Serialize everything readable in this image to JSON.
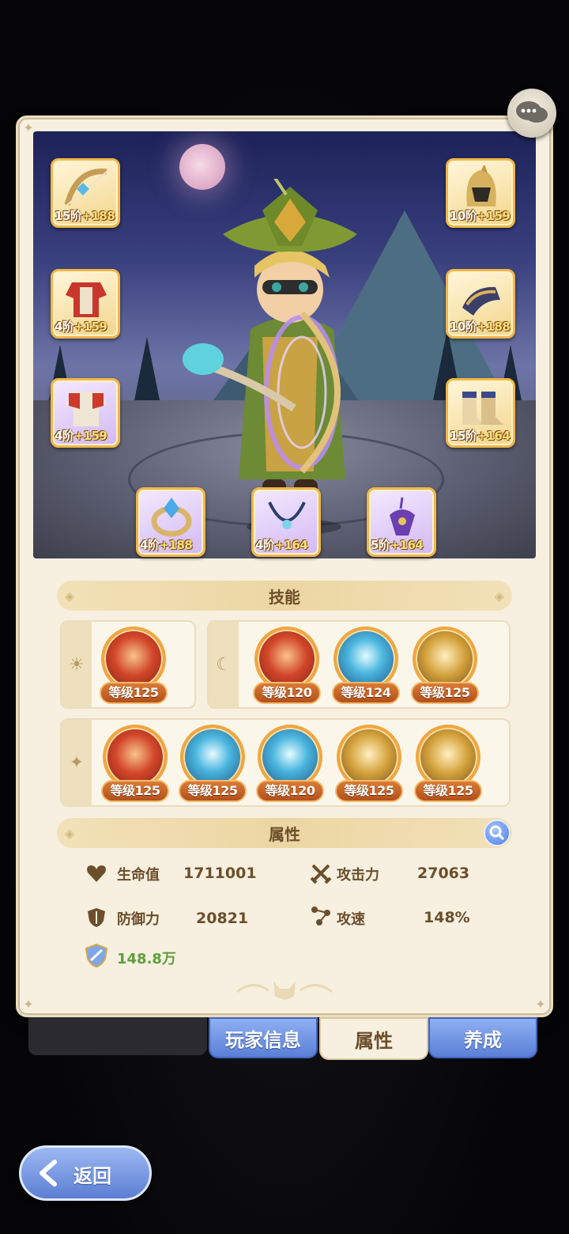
{
  "equipment": [
    {
      "slot": "weapon-bow",
      "tier": "15阶",
      "bonus": "+188",
      "rarity": "gold"
    },
    {
      "slot": "armor-chest",
      "tier": "4阶",
      "bonus": "+159",
      "rarity": "gold"
    },
    {
      "slot": "armor-chest-2",
      "tier": "4阶",
      "bonus": "+159",
      "rarity": "purple"
    },
    {
      "slot": "helmet",
      "tier": "10阶",
      "bonus": "+159",
      "rarity": "gold"
    },
    {
      "slot": "gauntlet",
      "tier": "10阶",
      "bonus": "+188",
      "rarity": "gold"
    },
    {
      "slot": "boots",
      "tier": "15阶",
      "bonus": "+164",
      "rarity": "gold"
    },
    {
      "slot": "ring",
      "tier": "4阶",
      "bonus": "+188",
      "rarity": "purple"
    },
    {
      "slot": "necklace",
      "tier": "4阶",
      "bonus": "+164",
      "rarity": "purple"
    },
    {
      "slot": "charm",
      "tier": "5阶",
      "bonus": "+164",
      "rarity": "purple"
    }
  ],
  "skills_section": {
    "title": "技能",
    "row1_left": [
      {
        "level": "等级125",
        "color": "red"
      }
    ],
    "row1_right": [
      {
        "level": "等级120",
        "color": "red"
      },
      {
        "level": "等级124",
        "color": "blue"
      },
      {
        "level": "等级125",
        "color": "gold"
      }
    ],
    "row2": [
      {
        "level": "等级125",
        "color": "red"
      },
      {
        "level": "等级125",
        "color": "blue"
      },
      {
        "level": "等级120",
        "color": "blue"
      },
      {
        "level": "等级125",
        "color": "gold"
      },
      {
        "level": "等级125",
        "color": "gold"
      }
    ]
  },
  "attributes_section": {
    "title": "属性",
    "hp_label": "生命值",
    "hp_value": "1711001",
    "atk_label": "攻击力",
    "atk_value": "27063",
    "def_label": "防御力",
    "def_value": "20821",
    "spd_label": "攻速",
    "spd_value": "148%",
    "power_value": "148.8万"
  },
  "tabs": [
    {
      "label": "玩家信息",
      "active": false
    },
    {
      "label": "属性",
      "active": true
    },
    {
      "label": "养成",
      "active": false
    }
  ],
  "back_label": "返回",
  "colors": {
    "panel": "#f7f0e1",
    "accent_gold": "#f0a640",
    "tab_blue": "#5a7fd6",
    "text_brown": "#6b4e2a",
    "power_green": "#5e9e3c"
  }
}
